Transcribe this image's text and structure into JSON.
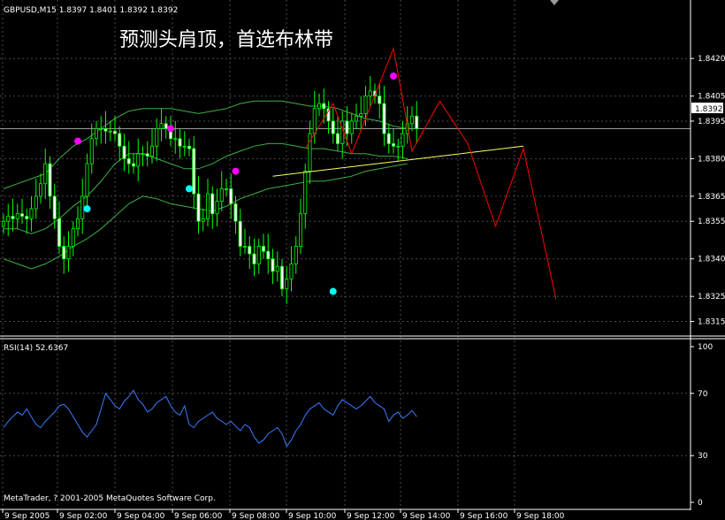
{
  "window": {
    "symbol_info": "GBPUSD,M15  1.8397 1.8401 1.8392 1.8392",
    "annotation": "预测头肩顶，首选布林带",
    "copyright": "MetaTrader, ? 2001-2005 MetaQuotes Software Corp."
  },
  "colors": {
    "background": "#000000",
    "grid": "#4a4a4a",
    "bull_candle": "#000000",
    "bear_candle": "#ffffff",
    "candle_wick": "#00ff00",
    "bollinger": "#3cb043",
    "neckline": "#ffff66",
    "forecast": "#ff0000",
    "rsi": "#3a7bff",
    "top_marker": "#ff00ff",
    "bottom_marker": "#00ffff"
  },
  "chart_data": [
    {
      "type": "candlestick",
      "title": "GBPUSD,M15  1.8397 1.8401 1.8392 1.8392",
      "ylim": [
        1.8312,
        1.8437
      ],
      "y_ticks": [
        "1.8420",
        "1.8405",
        "1.8395",
        "1.8380",
        "1.8365",
        "1.8355",
        "1.8340",
        "1.8325",
        "1.8315"
      ],
      "current_price": "1.8392",
      "x_ticks": [
        "9 Sep 2005",
        "9 Sep 02:00",
        "9 Sep 04:00",
        "9 Sep 06:00",
        "9 Sep 08:00",
        "9 Sep 10:00",
        "9 Sep 12:00",
        "9 Sep 14:00",
        "9 Sep 16:00",
        "9 Sep 18:00"
      ],
      "close": [
        1.8355,
        1.8357,
        1.8356,
        1.8358,
        1.8357,
        1.8356,
        1.836,
        1.8365,
        1.837,
        1.8378,
        1.8365,
        1.8356,
        1.8345,
        1.834,
        1.8345,
        1.8352,
        1.8356,
        1.8365,
        1.8378,
        1.8388,
        1.8392,
        1.8392,
        1.8391,
        1.8391,
        1.839,
        1.8385,
        1.838,
        1.8378,
        1.8377,
        1.8382,
        1.8382,
        1.8381,
        1.8385,
        1.8392,
        1.8394,
        1.8392,
        1.8388,
        1.8388,
        1.8385,
        1.8385,
        1.8384,
        1.8366,
        1.8355,
        1.8356,
        1.8366,
        1.8358,
        1.8363,
        1.8368,
        1.8368,
        1.8362,
        1.8355,
        1.8345,
        1.8345,
        1.8342,
        1.8338,
        1.8345,
        1.8343,
        1.834,
        1.8335,
        1.8337,
        1.8328,
        1.8332,
        1.8338,
        1.8345,
        1.8358,
        1.8375,
        1.839,
        1.84,
        1.8402,
        1.84,
        1.8395,
        1.839,
        1.8386,
        1.8395,
        1.839,
        1.8395,
        1.8397,
        1.8398,
        1.8405,
        1.8407,
        1.8405,
        1.8402,
        1.839,
        1.8386,
        1.8385,
        1.8385,
        1.839,
        1.8394,
        1.8397,
        1.8392
      ],
      "bollinger_upper": [
        1.8368,
        1.837,
        1.8372,
        1.8374,
        1.838,
        1.8385,
        1.8388,
        1.8392,
        1.8396,
        1.8399,
        1.84,
        1.84,
        1.84,
        1.8399,
        1.8398,
        1.8399,
        1.84,
        1.8402,
        1.8403,
        1.8403,
        1.8403,
        1.8402,
        1.8401,
        1.8401,
        1.84,
        1.8398,
        1.8396,
        1.8395,
        1.8393,
        1.8392
      ],
      "bollinger_middle": [
        1.8352,
        1.8352,
        1.835,
        1.8352,
        1.8356,
        1.8361,
        1.8365,
        1.8371,
        1.8378,
        1.8382,
        1.8382,
        1.838,
        1.8378,
        1.8376,
        1.8376,
        1.8378,
        1.8381,
        1.8383,
        1.8385,
        1.8386,
        1.8386,
        1.8385,
        1.8384,
        1.8384,
        1.8383,
        1.8382,
        1.8382,
        1.8381,
        1.8381,
        1.838
      ],
      "bollinger_lower": [
        1.834,
        1.8338,
        1.8336,
        1.8338,
        1.8341,
        1.8345,
        1.8348,
        1.8352,
        1.8357,
        1.8362,
        1.8365,
        1.8364,
        1.8362,
        1.8361,
        1.836,
        1.8359,
        1.8361,
        1.8364,
        1.8366,
        1.8368,
        1.8369,
        1.837,
        1.8371,
        1.8371,
        1.8372,
        1.8373,
        1.8375,
        1.8376,
        1.8377,
        1.8378
      ],
      "top_markers": [
        {
          "bar": 16,
          "price": 1.8387
        },
        {
          "bar": 36,
          "price": 1.8392
        },
        {
          "bar": 50,
          "price": 1.8375
        },
        {
          "bar": 84,
          "price": 1.8413
        }
      ],
      "bottom_markers": [
        {
          "bar": 18,
          "price": 1.836
        },
        {
          "bar": 40,
          "price": 1.8368
        },
        {
          "bar": 71,
          "price": 1.8327
        }
      ],
      "neckline": [
        {
          "bar": 58,
          "price": 1.8373
        },
        {
          "bar": 112,
          "price": 1.8385
        }
      ],
      "forecast": [
        {
          "bar": 94,
          "price": 1.8403
        },
        {
          "bar": 100,
          "price": 1.8386
        },
        {
          "bar": 106,
          "price": 1.8353
        },
        {
          "bar": 112,
          "price": 1.8384
        },
        {
          "bar": 119,
          "price": 1.8324
        }
      ],
      "head_shoulders_outline": [
        {
          "bar": 65,
          "price": 1.8384
        },
        {
          "bar": 71,
          "price": 1.8402
        },
        {
          "bar": 75,
          "price": 1.8382
        },
        {
          "bar": 84,
          "price": 1.8424
        },
        {
          "bar": 88,
          "price": 1.8383
        },
        {
          "bar": 94,
          "price": 1.8403
        }
      ]
    },
    {
      "type": "line",
      "title": "RSI(14) 52.6367",
      "ylim": [
        0,
        100
      ],
      "y_ticks": [
        "100",
        "70",
        "30",
        "0"
      ],
      "series": [
        {
          "name": "RSI(14)",
          "values": [
            48,
            52,
            55,
            58,
            56,
            60,
            55,
            50,
            48,
            52,
            55,
            58,
            62,
            63,
            60,
            55,
            50,
            45,
            42,
            46,
            50,
            60,
            70,
            66,
            62,
            60,
            65,
            68,
            72,
            66,
            63,
            58,
            60,
            64,
            66,
            68,
            62,
            58,
            56,
            62,
            50,
            48,
            52,
            54,
            56,
            58,
            54,
            52,
            50,
            52,
            49,
            46,
            50,
            48,
            42,
            38,
            40,
            44,
            46,
            48,
            44,
            36,
            40,
            46,
            50,
            56,
            60,
            62,
            64,
            60,
            58,
            56,
            62,
            66,
            64,
            62,
            60,
            62,
            65,
            68,
            64,
            62,
            60,
            52,
            56,
            58,
            54,
            56,
            59,
            55
          ]
        }
      ]
    }
  ]
}
